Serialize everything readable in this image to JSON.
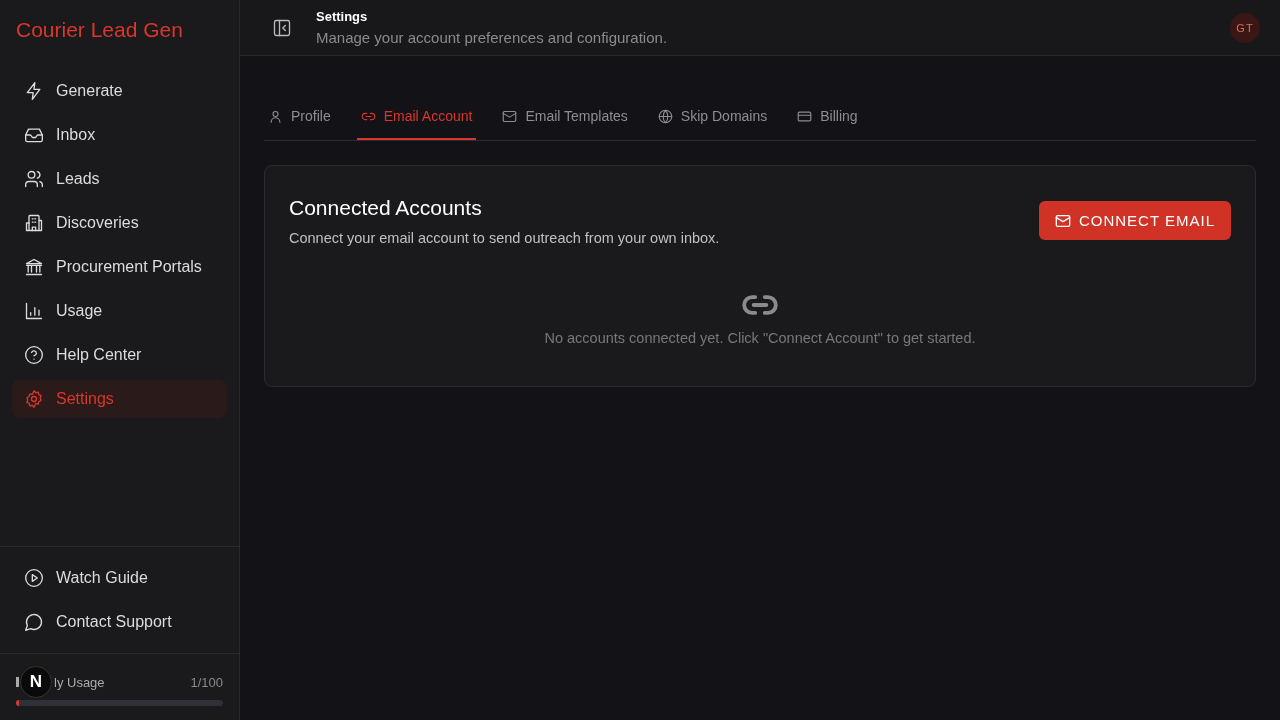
{
  "sidebar": {
    "brand": "Courier Lead Gen",
    "items": [
      {
        "label": "Generate",
        "selected": false
      },
      {
        "label": "Inbox",
        "selected": false
      },
      {
        "label": "Leads",
        "selected": false
      },
      {
        "label": "Discoveries",
        "selected": false
      },
      {
        "label": "Procurement Portals",
        "selected": false
      },
      {
        "label": "Usage",
        "selected": false
      },
      {
        "label": "Help Center",
        "selected": false
      },
      {
        "label": "Settings",
        "selected": true
      }
    ],
    "footer_items": [
      {
        "label": "Watch Guide"
      },
      {
        "label": "Contact Support"
      }
    ],
    "usage": {
      "badge": "N",
      "label": "ly Usage",
      "count": "1/100",
      "level": 0.01
    }
  },
  "header": {
    "title": "Settings",
    "subtitle": "Manage your account preferences and configuration.",
    "avatar": "GT"
  },
  "tabs": [
    {
      "label": "Profile",
      "selected": false
    },
    {
      "label": "Email Account",
      "selected": true
    },
    {
      "label": "Email Templates",
      "selected": false
    },
    {
      "label": "Skip Domains",
      "selected": false
    },
    {
      "label": "Billing",
      "selected": false
    }
  ],
  "card": {
    "title": "Connected Accounts",
    "description": "Connect your email account to send outreach from your own inbox.",
    "button": "CONNECT EMAIL",
    "empty_message": "No accounts connected yet. Click \"Connect Account\" to get started."
  }
}
